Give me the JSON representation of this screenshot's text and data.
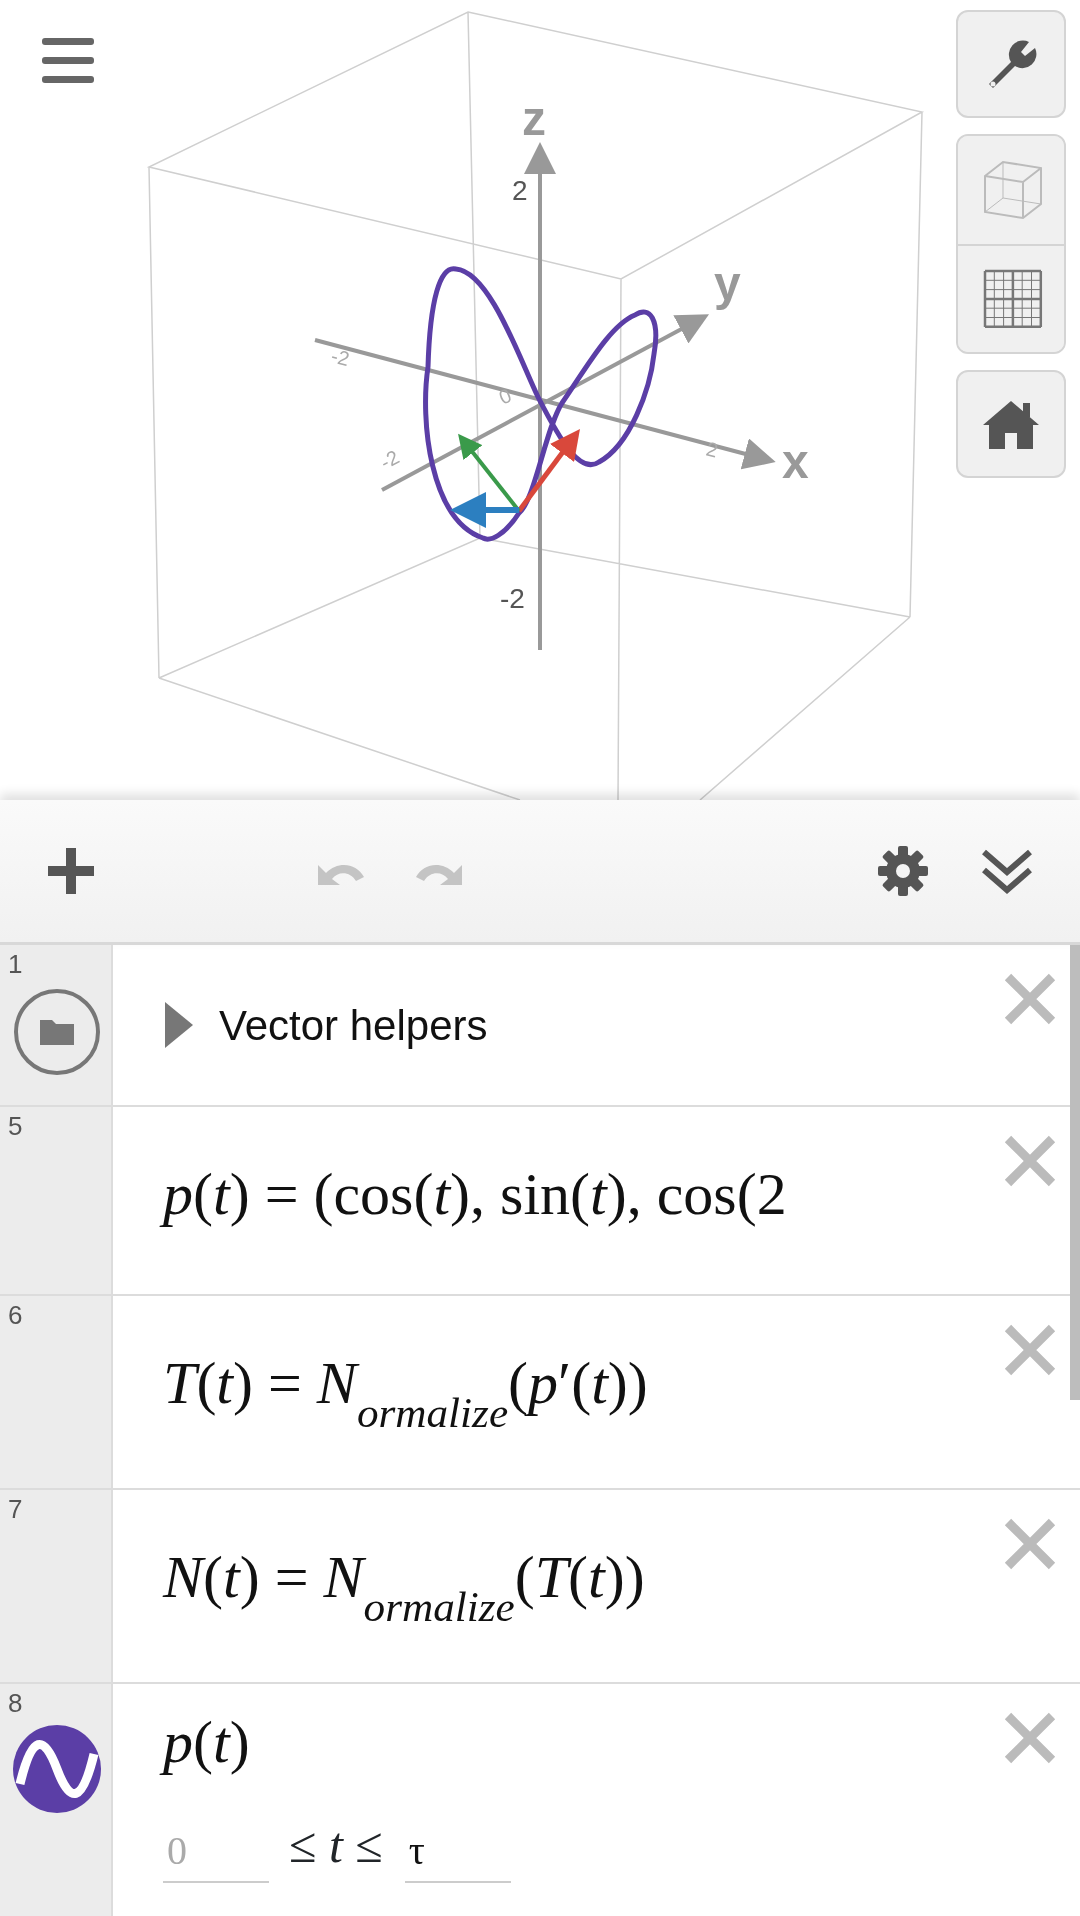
{
  "graph": {
    "axes": [
      {
        "name": "x",
        "ticks": [
          "-2",
          "2"
        ]
      },
      {
        "name": "y",
        "ticks": [
          "-2"
        ]
      },
      {
        "name": "z",
        "ticks": [
          "2",
          "-2"
        ]
      }
    ],
    "origin_label": "0"
  },
  "toolbar": [
    {
      "kind": "add",
      "disabled": false
    },
    {
      "kind": "undo",
      "disabled": true
    },
    {
      "kind": "redo",
      "disabled": true
    },
    {
      "kind": "settings",
      "disabled": false
    },
    {
      "kind": "collapse",
      "disabled": false
    }
  ],
  "expressions": [
    {
      "number": "1",
      "kind": "folder",
      "title": "Vector helpers",
      "expanded": false
    },
    {
      "number": "5",
      "kind": "math",
      "text": "*p*(*t*) = (cos(*t*), sin(*t*), cos(2"
    },
    {
      "number": "6",
      "kind": "math",
      "text": "*T*(*t*) = *N*$_{ormalize}$(*p*′(*t*))"
    },
    {
      "number": "7",
      "kind": "math",
      "text": "*N*(*t*) = *N*$_{ormalize}$(*T*(*t*))"
    },
    {
      "number": "8",
      "kind": "curve",
      "color": "#5b3ea6",
      "text": "*p*(*t*)",
      "domain": {
        "min": {
          "placeholder": "0"
        },
        "relation": "≤ *t* ≤",
        "max": {
          "value": "τ"
        }
      }
    }
  ]
}
